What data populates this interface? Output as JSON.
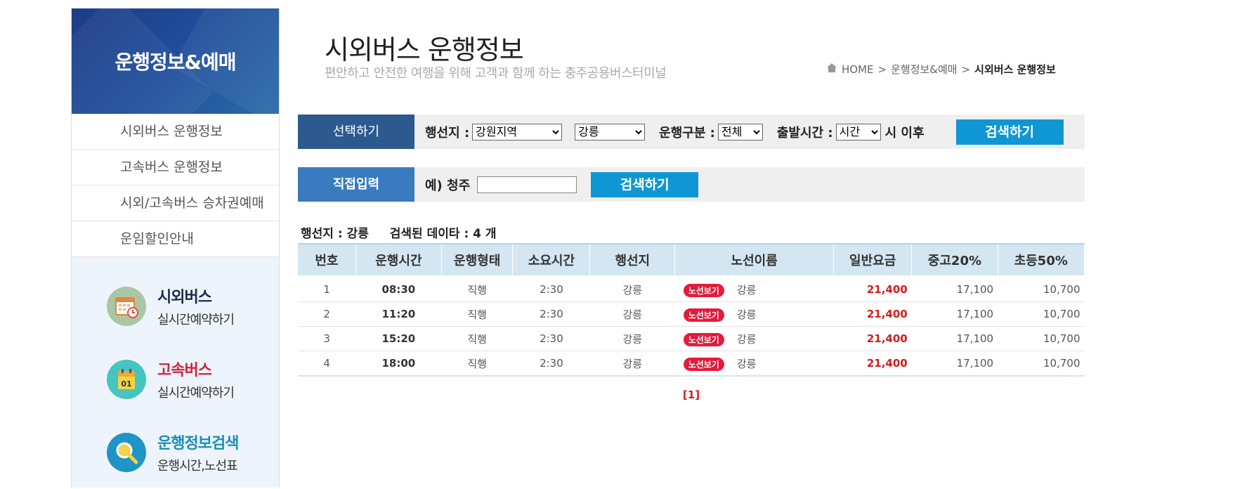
{
  "sidebar": {
    "title": "운행정보&예매",
    "items": [
      {
        "label": "시외버스 운행정보"
      },
      {
        "label": "고속버스 운행정보"
      },
      {
        "label": "시외/고속버스 승차권예매"
      },
      {
        "label": "운임할인안내"
      }
    ],
    "quick": [
      {
        "title": "시외버스",
        "sub": "실시간예약하기",
        "color": "#1a2b4a",
        "icon": "calendar-clock-icon"
      },
      {
        "title": "고속버스",
        "sub": "실시간예약하기",
        "color": "#d6213f",
        "icon": "calendar-01-icon",
        "icon_text": "01"
      },
      {
        "title": "운행정보검색",
        "sub": "운행시간,노선표",
        "color": "#1e94c7",
        "icon": "search-icon"
      }
    ]
  },
  "header": {
    "title": "시외버스 운행정보",
    "subtitle": "편안하고 안전한 여행을 위해 고객과 함께 하는 충주공용버스터미널"
  },
  "breadcrumb": {
    "home": "HOME",
    "sep": ">",
    "level1": "운행정보&예매",
    "current": "시외버스 운행정보"
  },
  "search_select": {
    "label": "선택하기",
    "dest_label": "행선지 :",
    "region_value": "강원지역",
    "city_value": "강릉",
    "type_label": "운행구분 :",
    "type_value": "전체",
    "depart_label": "출발시간 :",
    "depart_value": "시간",
    "after_text": "시 이후",
    "button": "검색하기"
  },
  "search_direct": {
    "label": "직접입력",
    "example": "예) 청주",
    "input_value": "",
    "button": "검색하기"
  },
  "summary": {
    "dest_text": "행선지 : 강릉",
    "count_text": "검색된 데이타 : 4 개"
  },
  "table": {
    "headers": [
      "번호",
      "운행시간",
      "운행형태",
      "소요시간",
      "행선지",
      "노선이름",
      "일반요금",
      "중고20%",
      "초등50%"
    ],
    "route_badge": "노선보기",
    "rows": [
      {
        "no": "1",
        "time": "08:30",
        "type": "직행",
        "duration": "2:30",
        "dest": "강릉",
        "route": "강릉",
        "fare": "21,400",
        "middle": "17,100",
        "elem": "10,700"
      },
      {
        "no": "2",
        "time": "11:20",
        "type": "직행",
        "duration": "2:30",
        "dest": "강릉",
        "route": "강릉",
        "fare": "21,400",
        "middle": "17,100",
        "elem": "10,700"
      },
      {
        "no": "3",
        "time": "15:20",
        "type": "직행",
        "duration": "2:30",
        "dest": "강릉",
        "route": "강릉",
        "fare": "21,400",
        "middle": "17,100",
        "elem": "10,700"
      },
      {
        "no": "4",
        "time": "18:00",
        "type": "직행",
        "duration": "2:30",
        "dest": "강릉",
        "route": "강릉",
        "fare": "21,400",
        "middle": "17,100",
        "elem": "10,700"
      }
    ]
  },
  "pager": {
    "current": "[1]"
  }
}
